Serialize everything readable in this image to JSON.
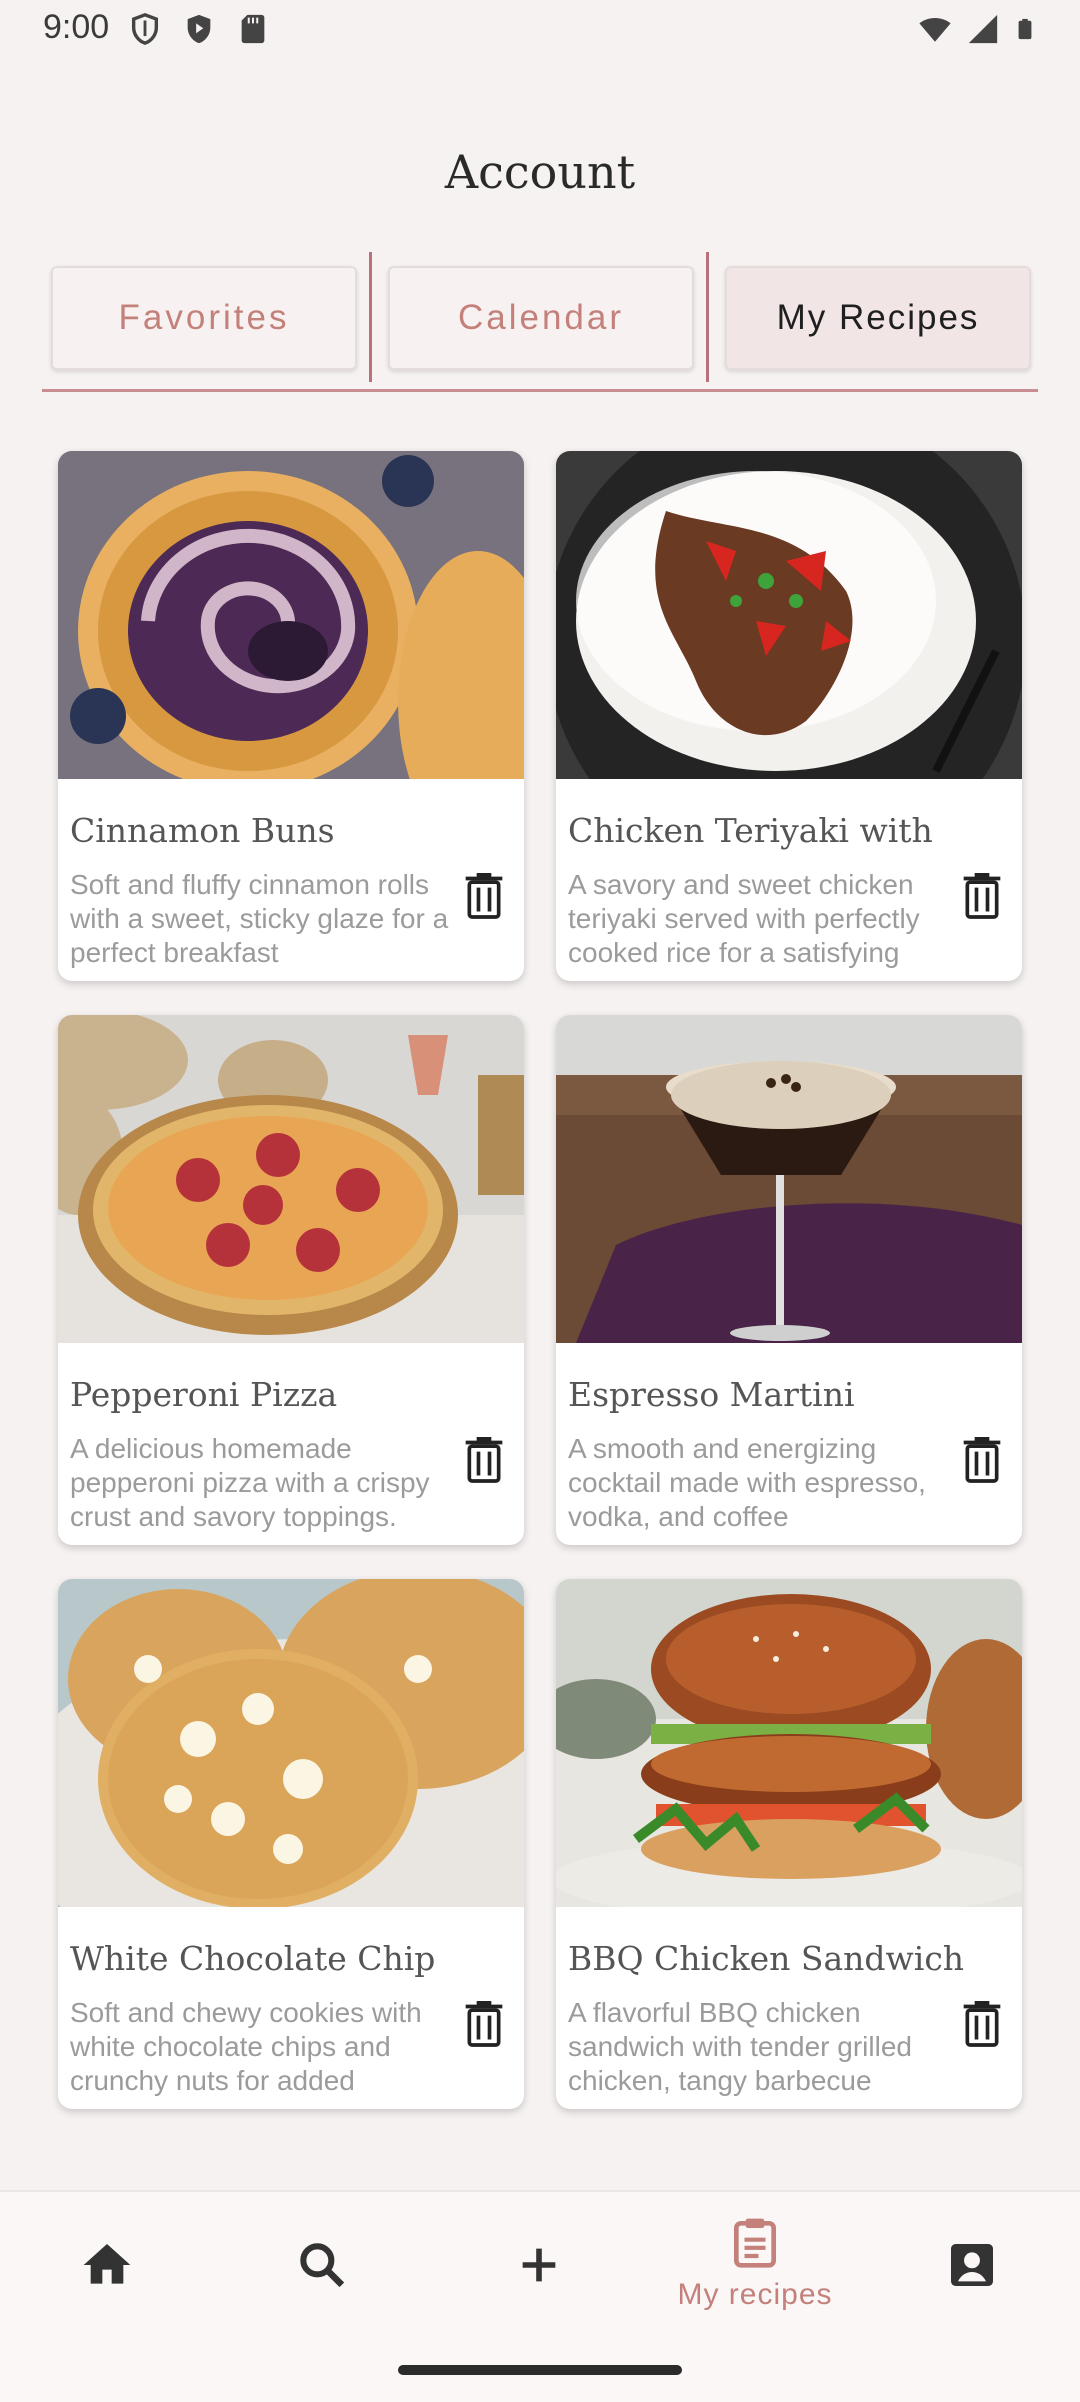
{
  "status_bar": {
    "time": "9:00",
    "left_icons": [
      "shield-icon",
      "play-protect-icon",
      "sd-card-icon"
    ],
    "right_icons": [
      "wifi-icon",
      "signal-icon",
      "battery-icon"
    ]
  },
  "header": {
    "title": "Account"
  },
  "tabs": [
    {
      "label": "Favorites",
      "active": false
    },
    {
      "label": "Calendar",
      "active": false
    },
    {
      "label": "My Recipes",
      "active": true
    }
  ],
  "recipes": [
    {
      "title": "Cinnamon Buns",
      "description": "Soft and fluffy cinnamon rolls with a sweet, sticky glaze for a perfect breakfast",
      "image": "blueberry-cinnamon-buns-photo"
    },
    {
      "title": "Chicken Teriyaki with",
      "description": "A savory and sweet chicken teriyaki served with perfectly cooked rice for a satisfying",
      "image": "teriyaki-with-rice-photo"
    },
    {
      "title": "Pepperoni Pizza",
      "description": "A delicious homemade pepperoni pizza with a crispy crust and savory toppings.",
      "image": "pepperoni-pizza-photo"
    },
    {
      "title": "Espresso Martini",
      "description": "A smooth and energizing cocktail made with espresso, vodka, and coffee",
      "image": "espresso-martini-photo"
    },
    {
      "title": "White Chocolate Chip",
      "description": "Soft and chewy cookies with white chocolate chips and crunchy nuts for added",
      "image": "white-chocolate-cookies-photo"
    },
    {
      "title": "BBQ Chicken Sandwich",
      "description": "A flavorful BBQ chicken sandwich with tender grilled chicken, tangy barbecue",
      "image": "bbq-chicken-sandwich-photo"
    }
  ],
  "bottom_nav": [
    {
      "name": "home",
      "icon": "home-icon",
      "label": ""
    },
    {
      "name": "search",
      "icon": "search-icon",
      "label": ""
    },
    {
      "name": "add",
      "icon": "plus-icon",
      "label": ""
    },
    {
      "name": "my-recipes",
      "icon": "clipboard-icon",
      "label": "My recipes",
      "active": true
    },
    {
      "name": "account",
      "icon": "account-box-icon",
      "label": ""
    }
  ],
  "colors": {
    "accent": "#c4807a",
    "tab_underline": "#c98c91",
    "background": "#f6f2f1"
  }
}
